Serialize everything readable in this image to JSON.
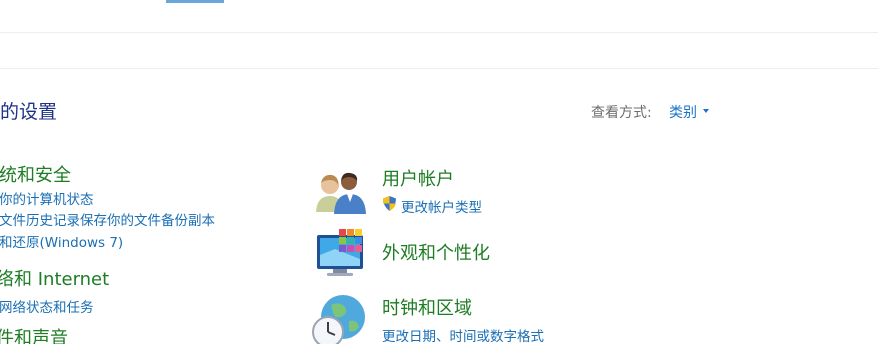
{
  "header": {
    "title": "的设置",
    "view_by_label": "查看方式:",
    "view_by_value": "类别"
  },
  "left_categories": [
    {
      "title": "统和安全",
      "links": [
        "你的计算机状态",
        "文件历史记录保存你的文件备份副本",
        "和还原(Windows 7)"
      ]
    },
    {
      "title": "络和 Internet",
      "links": [
        "网络状态和任务"
      ]
    },
    {
      "title": "件和声音",
      "links": []
    }
  ],
  "right_categories": [
    {
      "title": "用户帐户",
      "icon": "user-accounts-icon",
      "links": [
        "更改帐户类型"
      ],
      "link_icon": "uac-shield-icon"
    },
    {
      "title": "外观和个性化",
      "icon": "appearance-personalization-icon",
      "links": []
    },
    {
      "title": "时钟和区域",
      "icon": "clock-region-icon",
      "links": [
        "更改日期、时间或数字格式"
      ]
    }
  ],
  "colors": {
    "category_title": "#1e7d24",
    "link": "#1a6fb5",
    "page_title": "#1e3287",
    "label_gray": "#6d6d6d"
  }
}
